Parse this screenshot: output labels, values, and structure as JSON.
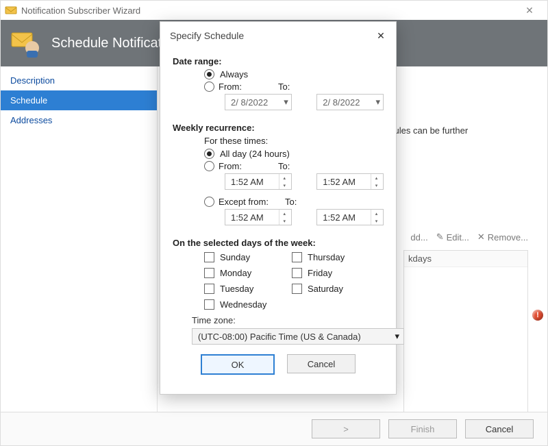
{
  "titlebar": {
    "title": "Notification Subscriber Wizard",
    "close": "✕"
  },
  "banner": {
    "title": "Schedule Notificati"
  },
  "sidebar": {
    "items": [
      "Description",
      "Schedule",
      "Addresses"
    ],
    "selected": 1
  },
  "content": {
    "hint_partial": "n schedules can be further"
  },
  "toolbar": {
    "add_suffix": "dd...",
    "edit": "Edit...",
    "remove": "Remove..."
  },
  "list": {
    "col_partial": "kdays"
  },
  "wizard_buttons": {
    "next_partial": ">",
    "finish": "Finish",
    "cancel": "Cancel"
  },
  "modal": {
    "title": "Specify Schedule",
    "date_range": {
      "heading": "Date range:",
      "always": "Always",
      "from_label": "From:",
      "to_label": "To:",
      "from_value": "2/  8/2022",
      "to_value": "2/  8/2022"
    },
    "weekly": {
      "heading": "Weekly recurrence:",
      "sub": "For these times:",
      "all_day": "All day (24 hours)",
      "from_label": "From:",
      "to_label": "To:",
      "except_label": "Except from:",
      "time1_from": "1:52 AM",
      "time1_to": "1:52 AM",
      "time2_from": "1:52 AM",
      "time2_to": "1:52 AM"
    },
    "days": {
      "heading": "On the selected days of the week:",
      "list": [
        "Sunday",
        "Monday",
        "Tuesday",
        "Wednesday",
        "Thursday",
        "Friday",
        "Saturday"
      ]
    },
    "tz": {
      "label": "Time zone:",
      "value": "(UTC-08:00) Pacific Time (US & Canada)"
    },
    "buttons": {
      "ok": "OK",
      "cancel": "Cancel"
    }
  },
  "icons": {
    "chev_down": "▾",
    "pencil": "✎",
    "x": "✕",
    "error": "!"
  }
}
